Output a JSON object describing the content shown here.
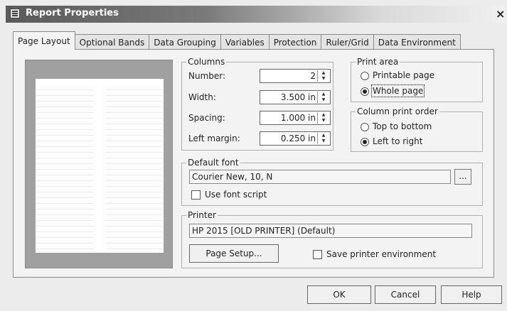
{
  "window": {
    "title": "Report Properties",
    "close": "×"
  },
  "tabs": [
    "Page Layout",
    "Optional Bands",
    "Data Grouping",
    "Variables",
    "Protection",
    "Ruler/Grid",
    "Data Environment"
  ],
  "columns": {
    "legend": "Columns",
    "number_label": "Number:",
    "number_value": "2",
    "width_label": "Width:",
    "width_value": "3.500 in",
    "spacing_label": "Spacing:",
    "spacing_value": "1.000 in",
    "left_margin_label": "Left margin:",
    "left_margin_value": "0.250 in"
  },
  "print_area": {
    "legend": "Print area",
    "options": [
      "Printable page",
      "Whole page"
    ],
    "selected": "Whole page"
  },
  "column_print_order": {
    "legend": "Column print order",
    "options": [
      "Top to bottom",
      "Left to right"
    ],
    "selected": "Left to right"
  },
  "default_font": {
    "legend": "Default font",
    "value": "Courier New, 10, N",
    "browse": "...",
    "use_font_script": "Use font script"
  },
  "printer": {
    "legend": "Printer",
    "value": "HP 2015 [OLD PRINTER] (Default)",
    "page_setup": "Page Setup...",
    "save_env": "Save printer environment"
  },
  "buttons": {
    "ok": "OK",
    "cancel": "Cancel",
    "help": "Help"
  },
  "spinner_up": "▲",
  "spinner_down": "▼"
}
